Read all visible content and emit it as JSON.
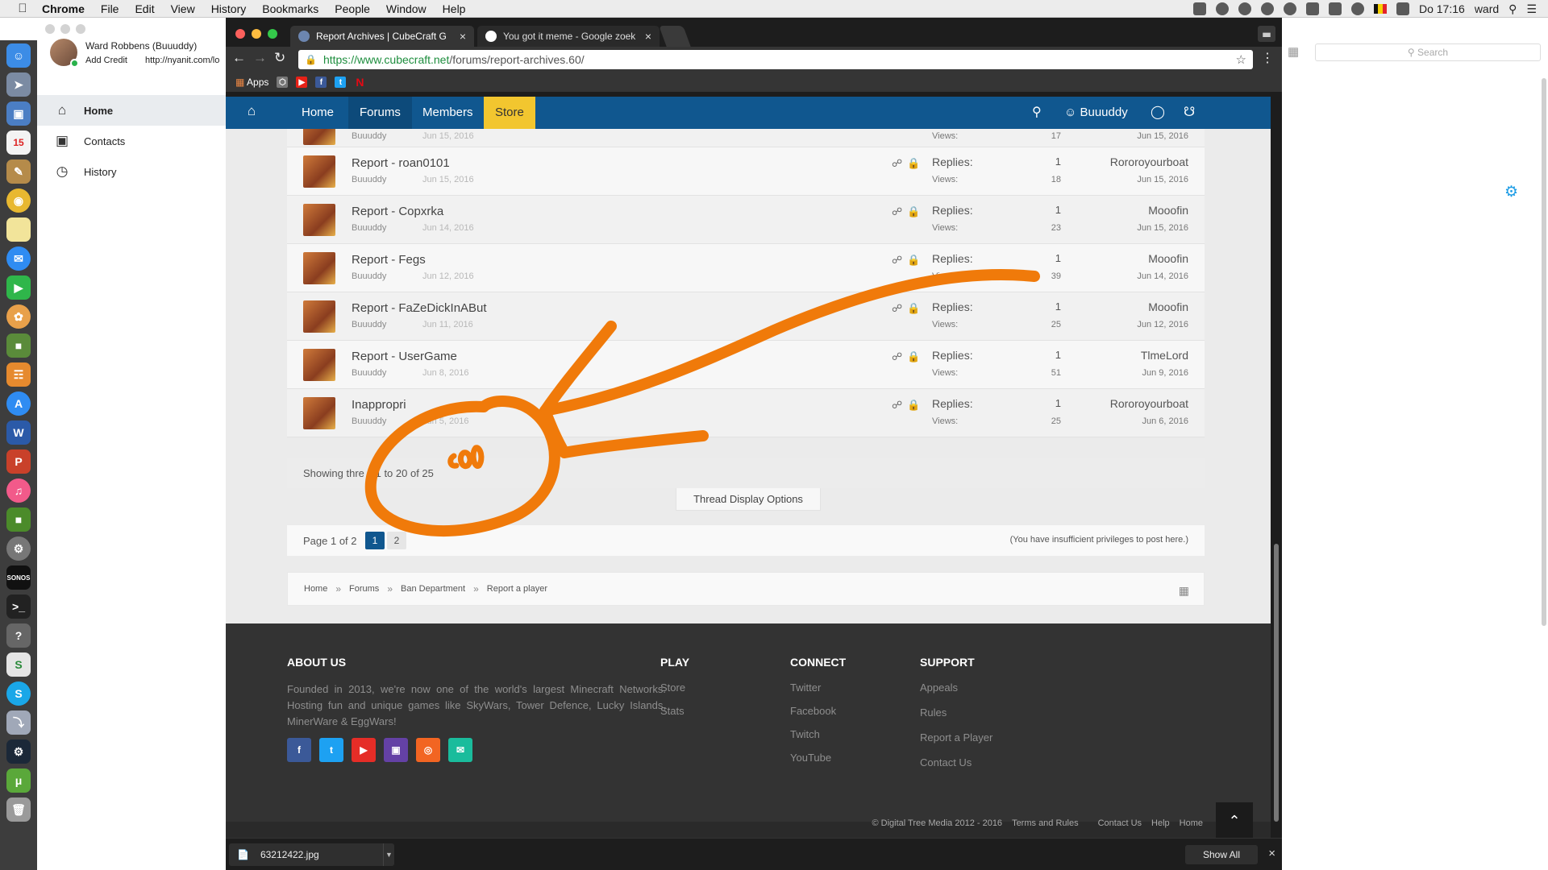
{
  "menubar": {
    "app": "Chrome",
    "items": [
      "File",
      "Edit",
      "View",
      "History",
      "Bookmarks",
      "People",
      "Window",
      "Help"
    ],
    "clock": "Do 17:16",
    "user": "ward"
  },
  "side_window": {
    "profile_name": "Ward Robbens (Buuuddy)",
    "add_credit": "Add Credit",
    "profile_link": "http://nyanit.com/lo",
    "nav": [
      {
        "label": "Home",
        "icon": "house-icon"
      },
      {
        "label": "Contacts",
        "icon": "contacts-icon"
      },
      {
        "label": "History",
        "icon": "clock-icon"
      }
    ]
  },
  "right_window": {
    "search_placeholder": "Search"
  },
  "chrome": {
    "tabs": [
      {
        "title": "Report Archives | CubeCraft G",
        "active": true
      },
      {
        "title": "You got it meme - Google zoek",
        "active": false
      }
    ],
    "url_host": "https://www.cubecraft.net",
    "url_path": "/forums/report-archives.60/",
    "bookmarks_apps": "Apps"
  },
  "site": {
    "nav": {
      "home": "Home",
      "forums": "Forums",
      "members": "Members",
      "store": "Store",
      "user": "Buuuddy"
    },
    "partial_thread": {
      "author": "Buuuddy",
      "date": "Jun 15, 2016",
      "views_label": "Views:",
      "views": "17",
      "last_date": "Jun 15, 2016"
    },
    "threads": [
      {
        "title": "Report - roan0101",
        "author": "Buuuddy",
        "date": "Jun 15, 2016",
        "replies": "1",
        "views": "18",
        "last_user": "Rororoyourboat",
        "last_date": "Jun 15, 2016"
      },
      {
        "title": "Report - Copxrka",
        "author": "Buuuddy",
        "date": "Jun 14, 2016",
        "replies": "1",
        "views": "23",
        "last_user": "Mooofin",
        "last_date": "Jun 15, 2016"
      },
      {
        "title": "Report - Fegs",
        "author": "Buuuddy",
        "date": "Jun 12, 2016",
        "replies": "1",
        "views": "39",
        "last_user": "Mooofin",
        "last_date": "Jun 14, 2016"
      },
      {
        "title": "Report - FaZeDickInABut",
        "author": "Buuuddy",
        "date": "Jun 11, 2016",
        "replies": "1",
        "views": "25",
        "last_user": "Mooofin",
        "last_date": "Jun 12, 2016"
      },
      {
        "title": "Report - UserGame",
        "author": "Buuuddy",
        "date": "Jun 8, 2016",
        "replies": "1",
        "views": "51",
        "last_user": "TlmeLord",
        "last_date": "Jun 9, 2016"
      },
      {
        "title": "Inappropri",
        "author": "Buuuddy",
        "date": "Jun 5, 2016",
        "replies": "1",
        "views": "25",
        "last_user": "Rororoyourboat",
        "last_date": "Jun 6, 2016"
      }
    ],
    "replies_label": "Replies:",
    "views_label": "Views:",
    "showing": "Showing thre  s 1 to 20 of 25",
    "thread_display_options": "Thread Display Options",
    "page_label": "Page 1 of 2",
    "page_current": "1",
    "page_next": "2",
    "privileges": "(You have insufficient privileges to post here.)",
    "breadcrumb": [
      "Home",
      "Forums",
      "Ban Department",
      "Report a player"
    ],
    "footer": {
      "about_title": "ABOUT US",
      "about_text": "Founded in 2013, we're now one of the world's largest Minecraft Networks. Hosting fun and unique games like SkyWars, Tower Defence, Lucky Islands, MinerWare & EggWars!",
      "play_title": "PLAY",
      "play_links": [
        "Store",
        "Stats"
      ],
      "connect_title": "CONNECT",
      "connect_links": [
        "Twitter",
        "Facebook",
        "Twitch",
        "YouTube"
      ],
      "support_title": "SUPPORT",
      "support_links": [
        "Appeals",
        "Rules",
        "Report a Player",
        "Contact Us"
      ],
      "copyright": "© Digital Tree Media 2012 - 2016",
      "bottom_links": [
        "Terms and Rules",
        "Contact Us",
        "Help",
        "Home"
      ]
    }
  },
  "downloads": {
    "file": "63212422.jpg",
    "show_all": "Show All"
  },
  "annotation_color": "#f07a0a"
}
